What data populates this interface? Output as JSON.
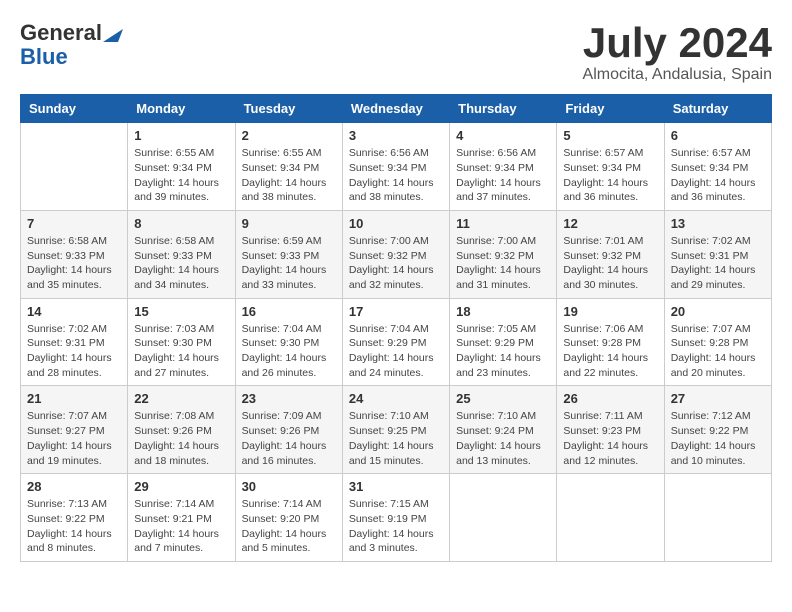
{
  "header": {
    "logo_general": "General",
    "logo_blue": "Blue",
    "month_title": "July 2024",
    "location": "Almocita, Andalusia, Spain"
  },
  "weekdays": [
    "Sunday",
    "Monday",
    "Tuesday",
    "Wednesday",
    "Thursday",
    "Friday",
    "Saturday"
  ],
  "weeks": [
    [
      {
        "day": "",
        "info": ""
      },
      {
        "day": "1",
        "info": "Sunrise: 6:55 AM\nSunset: 9:34 PM\nDaylight: 14 hours\nand 39 minutes."
      },
      {
        "day": "2",
        "info": "Sunrise: 6:55 AM\nSunset: 9:34 PM\nDaylight: 14 hours\nand 38 minutes."
      },
      {
        "day": "3",
        "info": "Sunrise: 6:56 AM\nSunset: 9:34 PM\nDaylight: 14 hours\nand 38 minutes."
      },
      {
        "day": "4",
        "info": "Sunrise: 6:56 AM\nSunset: 9:34 PM\nDaylight: 14 hours\nand 37 minutes."
      },
      {
        "day": "5",
        "info": "Sunrise: 6:57 AM\nSunset: 9:34 PM\nDaylight: 14 hours\nand 36 minutes."
      },
      {
        "day": "6",
        "info": "Sunrise: 6:57 AM\nSunset: 9:34 PM\nDaylight: 14 hours\nand 36 minutes."
      }
    ],
    [
      {
        "day": "7",
        "info": "Sunrise: 6:58 AM\nSunset: 9:33 PM\nDaylight: 14 hours\nand 35 minutes."
      },
      {
        "day": "8",
        "info": "Sunrise: 6:58 AM\nSunset: 9:33 PM\nDaylight: 14 hours\nand 34 minutes."
      },
      {
        "day": "9",
        "info": "Sunrise: 6:59 AM\nSunset: 9:33 PM\nDaylight: 14 hours\nand 33 minutes."
      },
      {
        "day": "10",
        "info": "Sunrise: 7:00 AM\nSunset: 9:32 PM\nDaylight: 14 hours\nand 32 minutes."
      },
      {
        "day": "11",
        "info": "Sunrise: 7:00 AM\nSunset: 9:32 PM\nDaylight: 14 hours\nand 31 minutes."
      },
      {
        "day": "12",
        "info": "Sunrise: 7:01 AM\nSunset: 9:32 PM\nDaylight: 14 hours\nand 30 minutes."
      },
      {
        "day": "13",
        "info": "Sunrise: 7:02 AM\nSunset: 9:31 PM\nDaylight: 14 hours\nand 29 minutes."
      }
    ],
    [
      {
        "day": "14",
        "info": "Sunrise: 7:02 AM\nSunset: 9:31 PM\nDaylight: 14 hours\nand 28 minutes."
      },
      {
        "day": "15",
        "info": "Sunrise: 7:03 AM\nSunset: 9:30 PM\nDaylight: 14 hours\nand 27 minutes."
      },
      {
        "day": "16",
        "info": "Sunrise: 7:04 AM\nSunset: 9:30 PM\nDaylight: 14 hours\nand 26 minutes."
      },
      {
        "day": "17",
        "info": "Sunrise: 7:04 AM\nSunset: 9:29 PM\nDaylight: 14 hours\nand 24 minutes."
      },
      {
        "day": "18",
        "info": "Sunrise: 7:05 AM\nSunset: 9:29 PM\nDaylight: 14 hours\nand 23 minutes."
      },
      {
        "day": "19",
        "info": "Sunrise: 7:06 AM\nSunset: 9:28 PM\nDaylight: 14 hours\nand 22 minutes."
      },
      {
        "day": "20",
        "info": "Sunrise: 7:07 AM\nSunset: 9:28 PM\nDaylight: 14 hours\nand 20 minutes."
      }
    ],
    [
      {
        "day": "21",
        "info": "Sunrise: 7:07 AM\nSunset: 9:27 PM\nDaylight: 14 hours\nand 19 minutes."
      },
      {
        "day": "22",
        "info": "Sunrise: 7:08 AM\nSunset: 9:26 PM\nDaylight: 14 hours\nand 18 minutes."
      },
      {
        "day": "23",
        "info": "Sunrise: 7:09 AM\nSunset: 9:26 PM\nDaylight: 14 hours\nand 16 minutes."
      },
      {
        "day": "24",
        "info": "Sunrise: 7:10 AM\nSunset: 9:25 PM\nDaylight: 14 hours\nand 15 minutes."
      },
      {
        "day": "25",
        "info": "Sunrise: 7:10 AM\nSunset: 9:24 PM\nDaylight: 14 hours\nand 13 minutes."
      },
      {
        "day": "26",
        "info": "Sunrise: 7:11 AM\nSunset: 9:23 PM\nDaylight: 14 hours\nand 12 minutes."
      },
      {
        "day": "27",
        "info": "Sunrise: 7:12 AM\nSunset: 9:22 PM\nDaylight: 14 hours\nand 10 minutes."
      }
    ],
    [
      {
        "day": "28",
        "info": "Sunrise: 7:13 AM\nSunset: 9:22 PM\nDaylight: 14 hours\nand 8 minutes."
      },
      {
        "day": "29",
        "info": "Sunrise: 7:14 AM\nSunset: 9:21 PM\nDaylight: 14 hours\nand 7 minutes."
      },
      {
        "day": "30",
        "info": "Sunrise: 7:14 AM\nSunset: 9:20 PM\nDaylight: 14 hours\nand 5 minutes."
      },
      {
        "day": "31",
        "info": "Sunrise: 7:15 AM\nSunset: 9:19 PM\nDaylight: 14 hours\nand 3 minutes."
      },
      {
        "day": "",
        "info": ""
      },
      {
        "day": "",
        "info": ""
      },
      {
        "day": "",
        "info": ""
      }
    ]
  ]
}
